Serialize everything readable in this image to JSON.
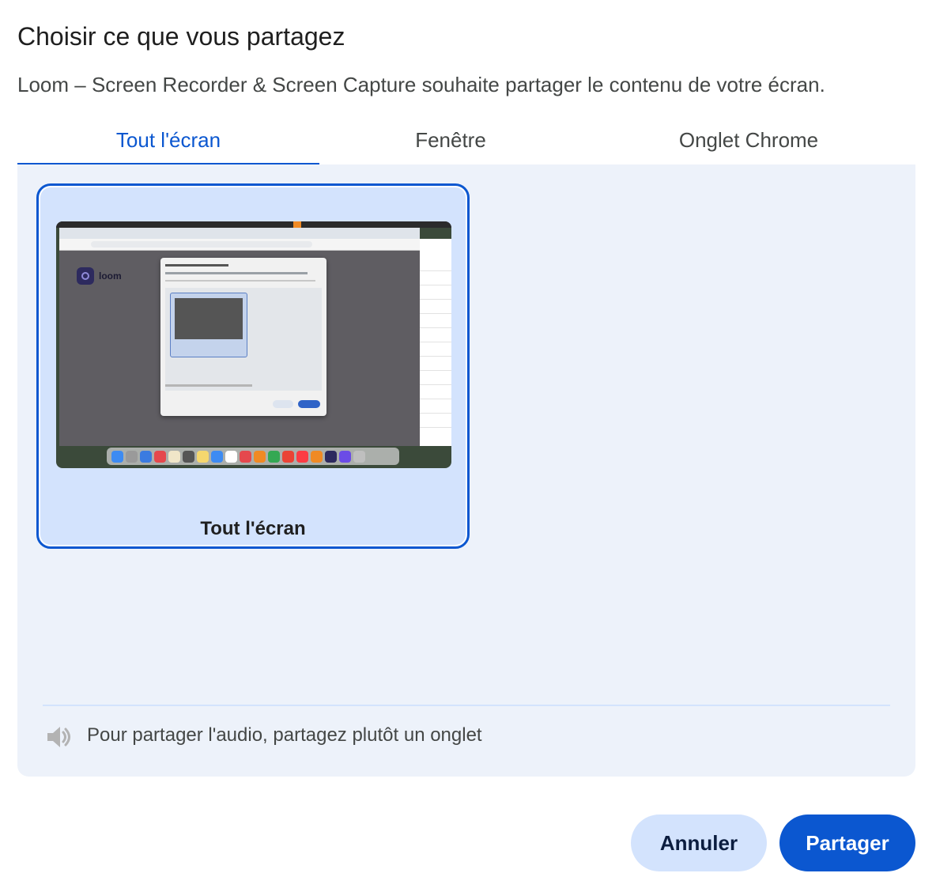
{
  "dialog": {
    "title": "Choisir ce que vous partagez",
    "subtitle": "Loom – Screen Recorder & Screen Capture souhaite partager le contenu de votre écran."
  },
  "tabs": [
    {
      "label": "Tout l'écran",
      "active": true
    },
    {
      "label": "Fenêtre",
      "active": false
    },
    {
      "label": "Onglet Chrome",
      "active": false
    }
  ],
  "sources": [
    {
      "label": "Tout l'écran",
      "selected": true,
      "thumbnail": {
        "app_logo_text": "loom"
      }
    }
  ],
  "audio": {
    "icon": "speaker-icon",
    "message": "Pour partager l'audio, partagez plutôt un onglet"
  },
  "actions": {
    "cancel_label": "Annuler",
    "share_label": "Partager"
  },
  "colors": {
    "accent": "#0b57d0",
    "panel_bg": "#edf2fa",
    "selected_card_bg": "#d3e3fd"
  }
}
